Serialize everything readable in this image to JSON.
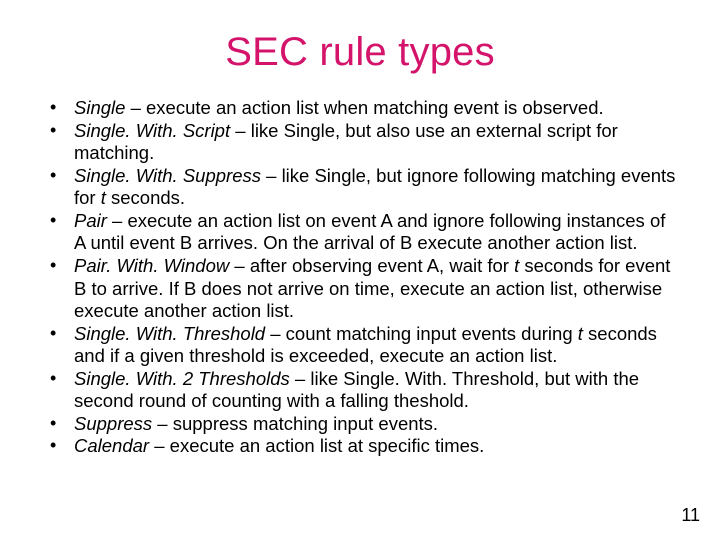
{
  "slide": {
    "title": "SEC rule types",
    "title_color": "#d4136b",
    "page_number": "11",
    "items": [
      {
        "term": "Single",
        "sep": " – ",
        "desc_before": "execute an action list when matching event is observed.",
        "tvar": "",
        "desc_after": ""
      },
      {
        "term": "Single. With. Script",
        "sep": " – ",
        "desc_before": "like Single, but also use an external script for matching.",
        "tvar": "",
        "desc_after": ""
      },
      {
        "term": "Single. With. Suppress",
        "sep": " – ",
        "desc_before": "like Single, but ignore following matching events for ",
        "tvar": "t",
        "desc_after": " seconds."
      },
      {
        "term": "Pair",
        "sep": " – ",
        "desc_before": "execute an action list on event A and ignore following instances of A until event B arrives. On the arrival of B execute another action list.",
        "tvar": "",
        "desc_after": ""
      },
      {
        "term": "Pair. With. Window",
        "sep": " – ",
        "desc_before": "after observing event A, wait for ",
        "tvar": "t",
        "desc_after": " seconds for event B to arrive. If B does not arrive on time, execute an action list, otherwise execute another action list."
      },
      {
        "term": "Single. With. Threshold",
        "sep": " – ",
        "desc_before": "count matching input events during ",
        "tvar": "t",
        "desc_after": " seconds and if a given threshold is exceeded, execute an action list."
      },
      {
        "term": "Single. With. 2 Thresholds",
        "sep": " – ",
        "desc_before": "like Single. With. Threshold, but with the second round of counting with a falling theshold.",
        "tvar": "",
        "desc_after": ""
      },
      {
        "term": "Suppress",
        "sep": " – ",
        "desc_before": "suppress matching input events.",
        "tvar": "",
        "desc_after": ""
      },
      {
        "term": "Calendar",
        "sep": " – ",
        "desc_before": "execute an action list at specific times.",
        "tvar": "",
        "desc_after": ""
      }
    ]
  }
}
